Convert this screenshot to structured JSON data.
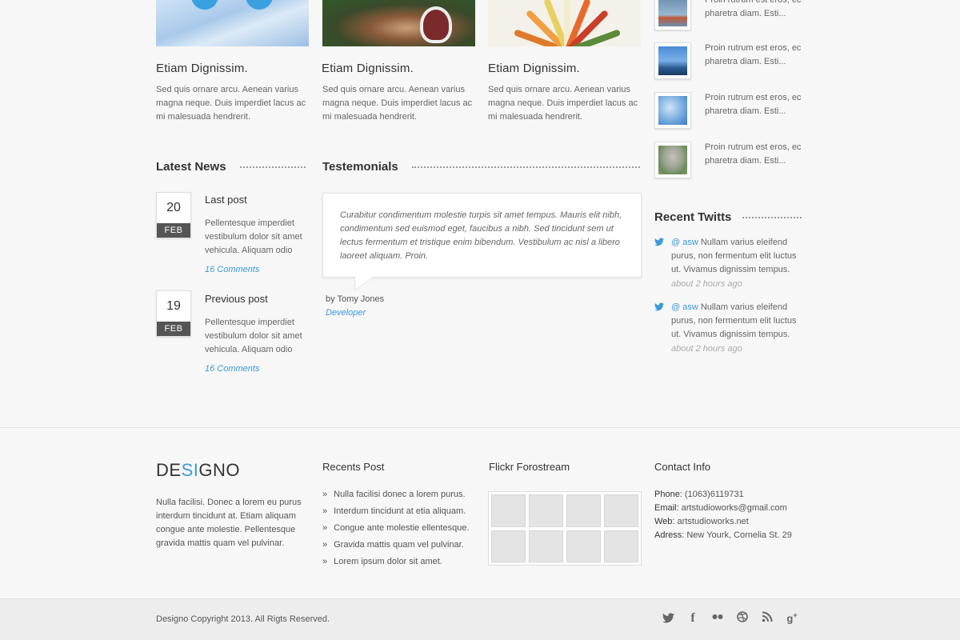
{
  "cards": [
    {
      "title": "Etiam Dignissim.",
      "text": "Sed quis ornare arcu. Aenean varius magna neque. Duis imperdiet lacus ac mi malesuada hendrerit.",
      "image": "ice"
    },
    {
      "title": "Etiam Dignissim.",
      "text": "Sed quis ornare arcu. Aenean varius magna neque. Duis imperdiet lacus ac mi malesuada hendrerit.",
      "image": "animal"
    },
    {
      "title": "Etiam Dignissim.",
      "text": "Sed quis ornare arcu. Aenean varius magna neque. Duis imperdiet lacus ac mi malesuada hendrerit.",
      "image": "vegetables"
    }
  ],
  "sidebar_posts": [
    {
      "text": "Proin rutrum est eros, ec pharetra diam. Esti..."
    },
    {
      "text": "Proin rutrum est eros, ec pharetra diam. Esti..."
    },
    {
      "text": "Proin rutrum est eros, ec pharetra diam. Esti..."
    },
    {
      "text": "Proin rutrum est eros, ec pharetra diam. Esti..."
    }
  ],
  "latest_news": {
    "heading": "Latest News",
    "posts": [
      {
        "day": "20",
        "month": "FEB",
        "title": "Last post",
        "text": "Pellentesque imperdiet vestibulum dolor sit amet vehicula. Aliquam odio",
        "comments": "16 Comments"
      },
      {
        "day": "19",
        "month": "FEB",
        "title": "Previous post",
        "text": "Pellentesque imperdiet vestibulum dolor sit amet vehicula. Aliquam odio",
        "comments": "16 Comments"
      }
    ]
  },
  "testimonials": {
    "heading": "Testemonials",
    "quote": "Curabitur condimentum molestie turpis sit amet tempus. Mauris elit nibh, condimentum sed euismod eget, faucibus a nibh. Sed tincidunt sem ut lectus fermentum et tristique enim bibendum. Vestibulum ac nisl a libero laoreet aliquam. Proin.",
    "author": "by Tomy Jones",
    "role": "Developer"
  },
  "recent_twitts": {
    "heading": "Recent Twitts",
    "items": [
      {
        "handle": "@ asw",
        "text": " Nullam varius eleifend purus, non fermentum elit luctus ut. Vivamus dignissim tempus.",
        "time": "about 2 hours ago"
      },
      {
        "handle": "@ asw",
        "text": " Nullam varius eleifend purus, non fermentum elit luctus ut. Vivamus dignissim tempus.",
        "time": "about 2 hours ago"
      }
    ]
  },
  "footer": {
    "logo_part1": "DE",
    "logo_part2": "SI",
    "logo_part3": "GNO",
    "about": "Nulla facilisi. Donec a lorem eu purus interdum tincidunt at. Etiam aliquam congue ante molestie. Pellentesque gravida mattis quam vel pulvinar.",
    "recent_title": "Recents Post",
    "recent_items": [
      "Nulla facilisi donec a lorem purus.",
      "Interdum tincidunt at etia aliquam.",
      "Congue ante molestie ellentesque.",
      "Gravida mattis quam vel pulvinar.",
      "Lorem ipsum dolor sit amet."
    ],
    "flickr_title": "Flickr Forostream",
    "contact_title": "Contact Info",
    "contact": {
      "phone_label": "Phone:",
      "phone": " (1063)6119731",
      "email_label": "Email:",
      "email": " artstudioworks@gmail.com",
      "web_label": "Web:",
      "web": " artstudioworks.net",
      "address_label": "Adress:",
      "address": " New Yourk, Cornelia St. 29"
    },
    "copyright": "Designo Copyright 2013. All Rigts Reserved.",
    "social": [
      "twitter-icon",
      "facebook-icon",
      "flickr-icon",
      "dribbble-icon",
      "rss-icon",
      "google-plus-icon"
    ]
  },
  "colors": {
    "accent": "#3a9ad9",
    "text": "#555555",
    "heading": "#333333"
  }
}
